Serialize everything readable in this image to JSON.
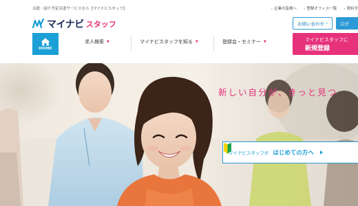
{
  "header": {
    "tagline": "派遣・紹介予定派遣サービスなら【マイナビスタッフ】",
    "top_links": [
      "企業の皆様へ",
      "登録オフィス一覧",
      "資料ダ"
    ],
    "logo_main": "マイナビ",
    "logo_sub": "スタッフ",
    "contact_label": "お問い合わせ",
    "login_label": "ログ"
  },
  "nav": {
    "home_label": "HOME",
    "items": [
      {
        "label": "求人検索"
      },
      {
        "label": "マイナビスタッフを知る"
      },
      {
        "label": "登録会・セミナー"
      }
    ],
    "register_line1": "マイナビスタッフに",
    "register_line2": "新規登録"
  },
  "hero": {
    "catch": "新しい自分が、きっと見つ",
    "first_time_pre": "マイナビスタッフが",
    "first_time_main": "はじめての方へ"
  },
  "colors": {
    "brand_blue": "#1a9fd6",
    "brand_pink": "#e6317b",
    "logo_navy": "#1b2b5a"
  }
}
